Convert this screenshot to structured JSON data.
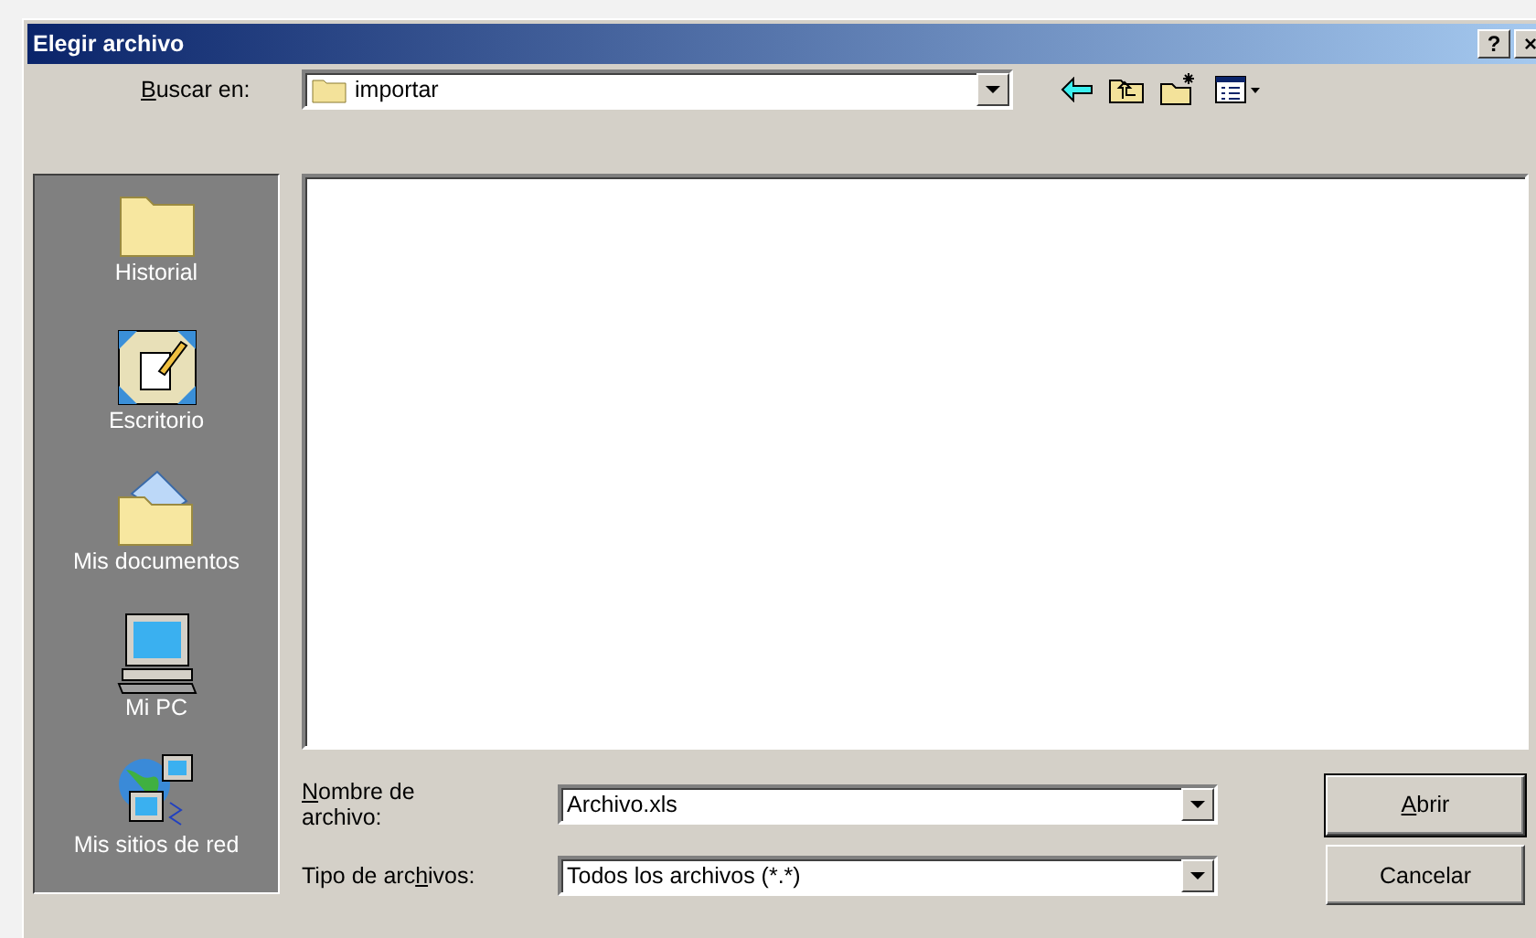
{
  "window": {
    "title": "Elegir archivo",
    "title_buttons": [
      "?",
      "×"
    ]
  },
  "look_in": {
    "label": {
      "key": "B",
      "post": "uscar en:"
    },
    "value": "importar"
  },
  "toolbar": [
    {
      "kind": "back"
    },
    {
      "kind": "up"
    },
    {
      "kind": "new-folder"
    },
    {
      "kind": "view"
    }
  ],
  "places": [
    {
      "kind": "history",
      "label": "Historial"
    },
    {
      "kind": "desktop",
      "label": "Escritorio"
    },
    {
      "kind": "documents",
      "label": "Mis documentos"
    },
    {
      "kind": "computer",
      "label": "Mi PC"
    },
    {
      "kind": "network",
      "label": "Mis sitios de red"
    }
  ],
  "file_name": {
    "label": {
      "key": "N",
      "post": "ombre de archivo:"
    },
    "value": "Archivo.xls"
  },
  "file_type": {
    "label": {
      "pre": "Tipo de arc",
      "key": "h",
      "post": "ivos:"
    },
    "value": "Todos los archivos (*.*)"
  },
  "buttons": [
    {
      "label": {
        "key": "A",
        "post": "brir"
      },
      "default": true
    },
    {
      "label": {
        "pre": "Cancelar"
      },
      "default": false
    }
  ]
}
